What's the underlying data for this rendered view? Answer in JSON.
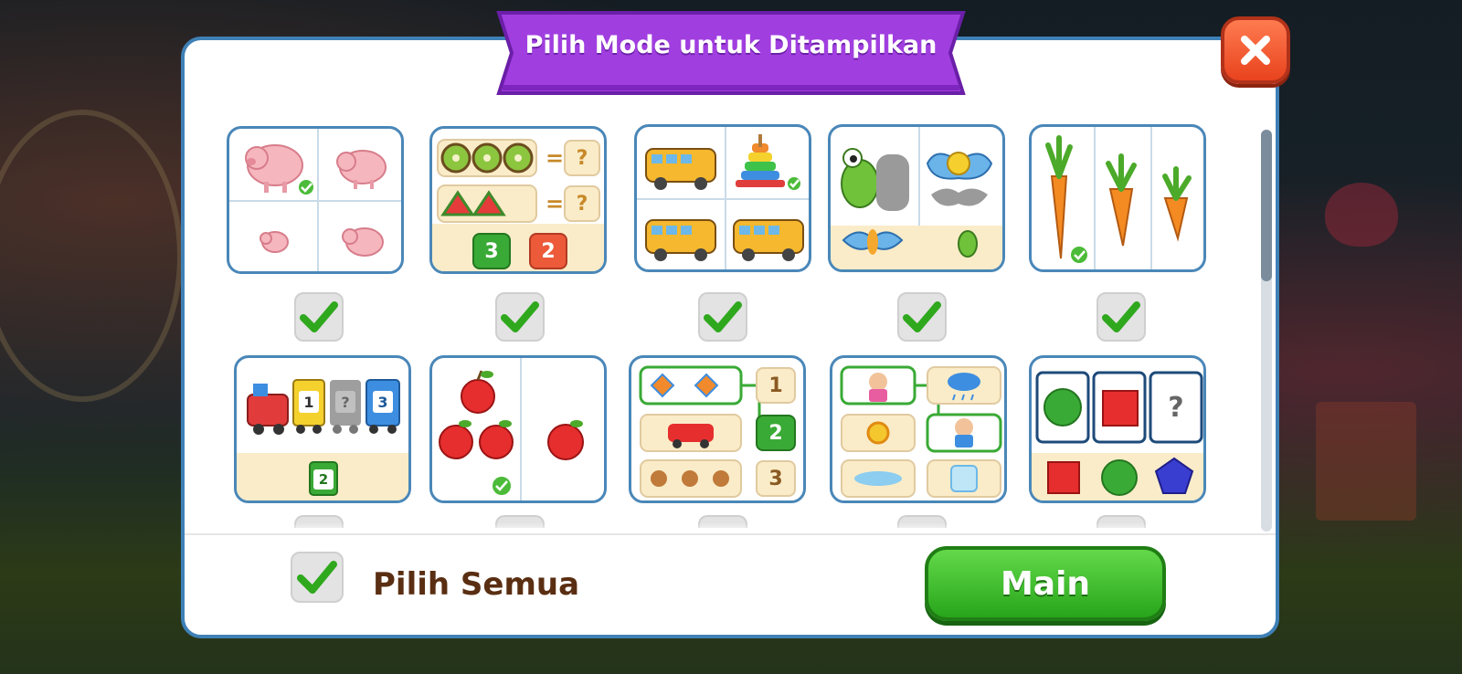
{
  "dialog": {
    "title": "Pilih Mode untuk Ditampilkan",
    "close_icon": "close-x-icon"
  },
  "modes": [
    {
      "id": "size-compare",
      "checked": true,
      "icon": "pig-size-icon"
    },
    {
      "id": "counting-compare",
      "checked": true,
      "icon": "kiwi-watermelon-count-icon",
      "labels": [
        "?",
        "?"
      ],
      "numbers": [
        "3",
        "2"
      ]
    },
    {
      "id": "odd-one-out",
      "checked": true,
      "icon": "bus-ring-toy-icon"
    },
    {
      "id": "shadow-match",
      "checked": true,
      "icon": "frog-butterfly-shadow-icon"
    },
    {
      "id": "size-order",
      "checked": true,
      "icon": "carrot-size-icon"
    },
    {
      "id": "number-sequence",
      "checked": true,
      "icon": "train-number-icon",
      "numbers": [
        "1",
        "?",
        "3",
        "2"
      ]
    },
    {
      "id": "quantity-compare",
      "checked": true,
      "icon": "apple-count-icon"
    },
    {
      "id": "count-match",
      "checked": true,
      "icon": "kite-car-bear-count-icon",
      "numbers": [
        "1",
        "2",
        "3"
      ]
    },
    {
      "id": "association-match",
      "checked": true,
      "icon": "girl-cloud-sun-match-icon"
    },
    {
      "id": "pattern-complete",
      "checked": true,
      "icon": "shape-pattern-icon",
      "labels": [
        "?"
      ]
    }
  ],
  "footer": {
    "select_all_label": "Pilih Semua",
    "select_all_checked": true,
    "play_label": "Main"
  },
  "colors": {
    "panel_border": "#3f80b6",
    "ribbon": "#a13ee0",
    "close_button": "#f0552a",
    "play_button": "#34b523",
    "check": "#2fa81e",
    "label_text": "#5a2e12"
  }
}
